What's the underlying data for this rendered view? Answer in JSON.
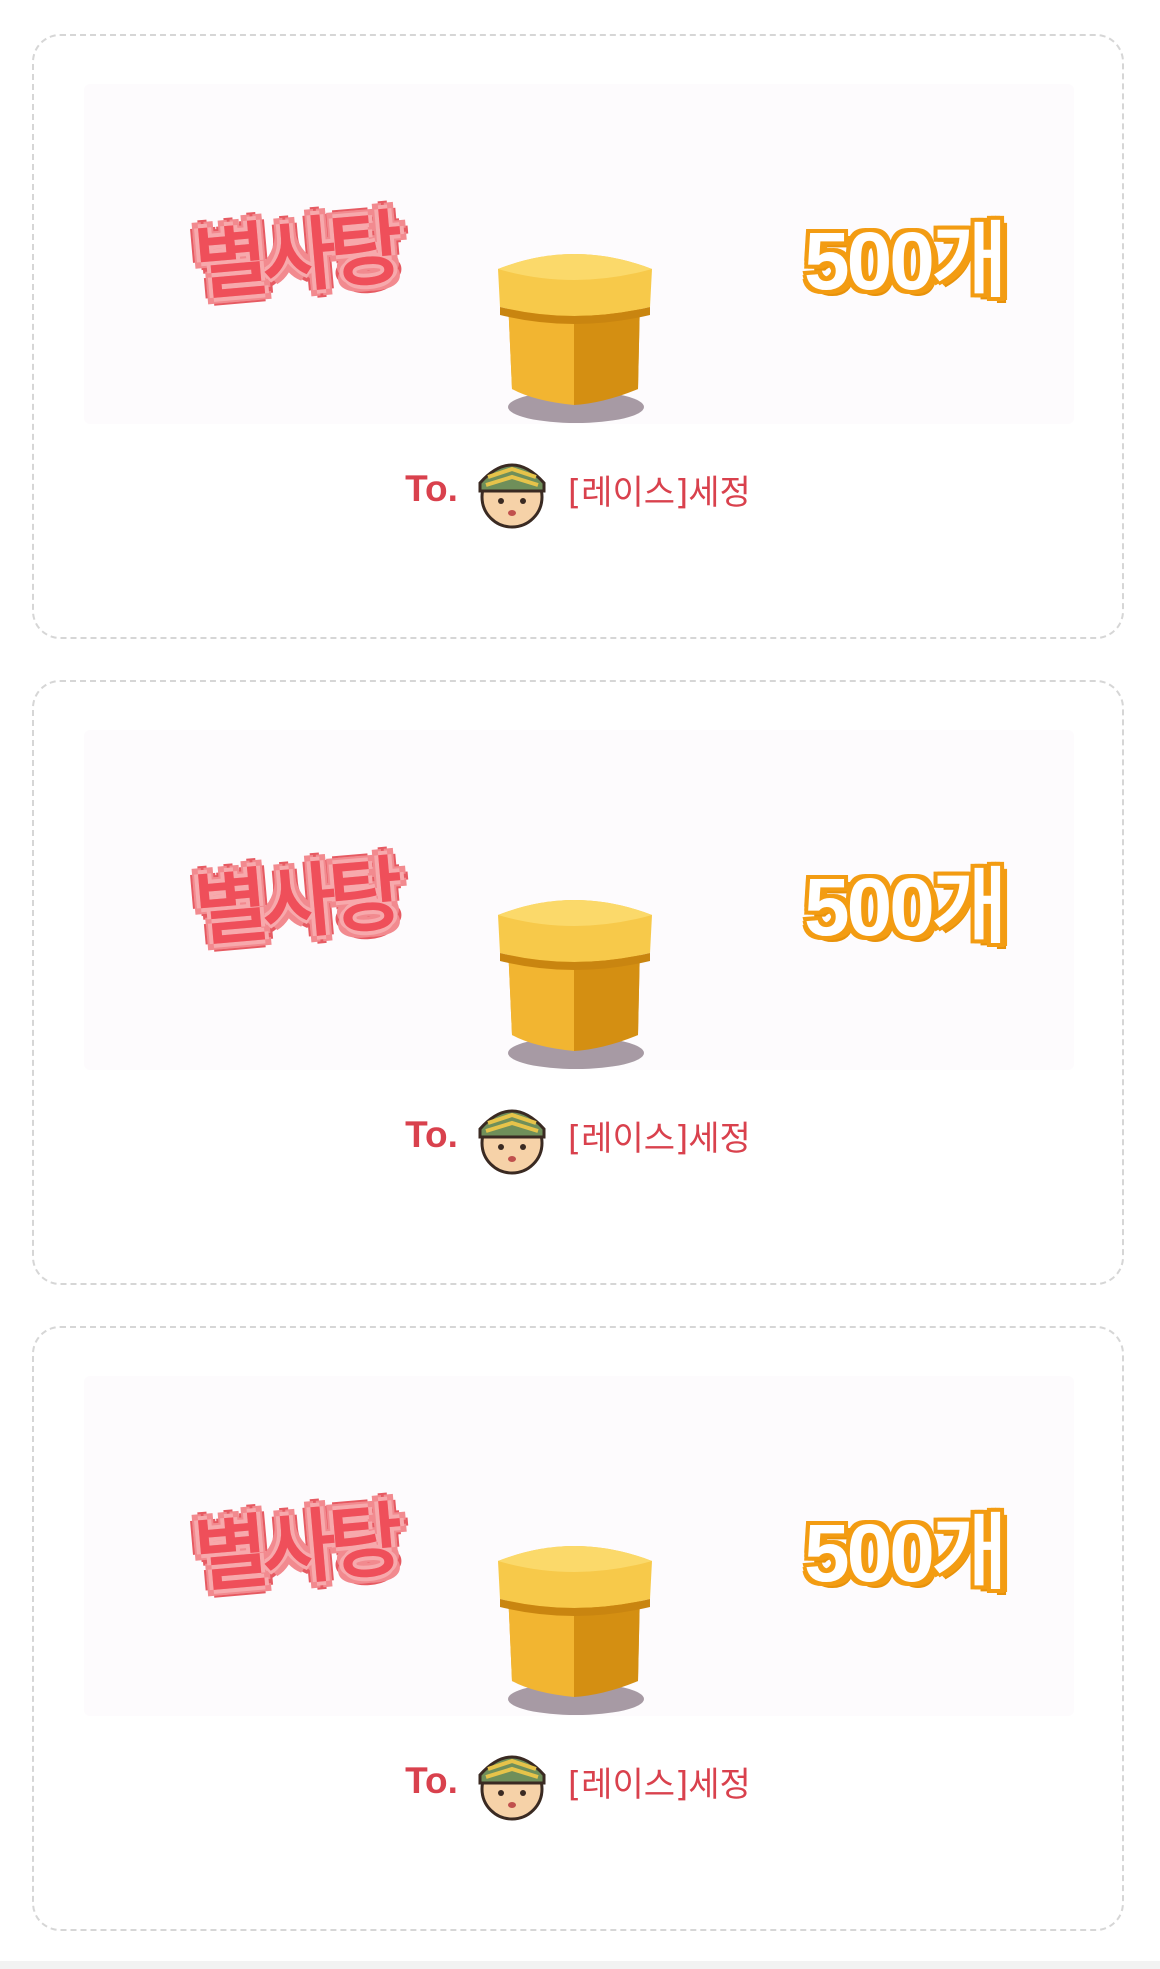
{
  "cards": [
    {
      "item_name": "별사탕",
      "quantity": "500개",
      "recipient_prefix": "To.",
      "recipient_name": "[레이스]세정",
      "item_icon": "gift-box-icon",
      "avatar_icon": "soldier-avatar-icon"
    },
    {
      "item_name": "별사탕",
      "quantity": "500개",
      "recipient_prefix": "To.",
      "recipient_name": "[레이스]세정",
      "item_icon": "gift-box-icon",
      "avatar_icon": "soldier-avatar-icon"
    },
    {
      "item_name": "별사탕",
      "quantity": "500개",
      "recipient_prefix": "To.",
      "recipient_name": "[레이스]세정",
      "item_icon": "gift-box-icon",
      "avatar_icon": "soldier-avatar-icon"
    }
  ],
  "colors": {
    "item_name": "#ef4f5a",
    "quantity_outline": "#f39c12",
    "recipient_text": "#d9414d",
    "card_border": "#d6d6d6",
    "box_gold": "#f2b531"
  }
}
